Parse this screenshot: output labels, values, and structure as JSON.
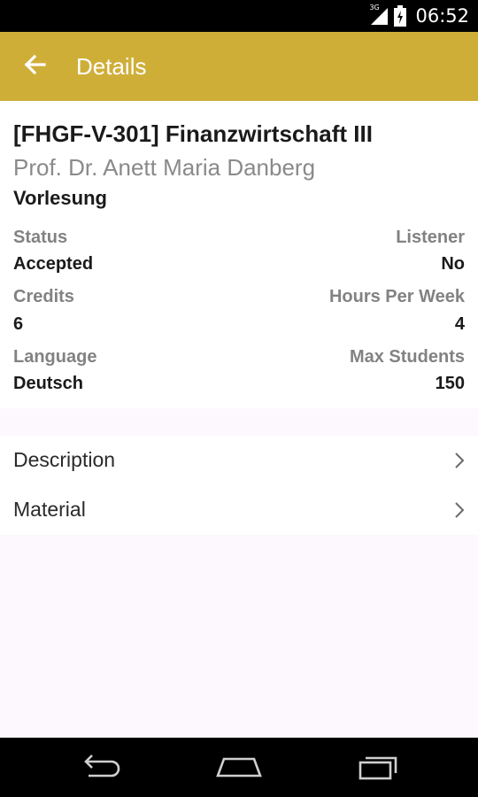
{
  "status_bar": {
    "network_type": "3G",
    "time": "06:52",
    "icons": [
      "signal-icon",
      "battery-icon"
    ]
  },
  "app_bar": {
    "title": "Details",
    "back_icon": "arrow-left-icon",
    "color": "#cfae38"
  },
  "course": {
    "title": "[FHGF-V-301] Finanzwirtschaft III",
    "professor": "Prof. Dr. Anett Maria Danberg",
    "type": "Vorlesung"
  },
  "info": {
    "status_label": "Status",
    "status_value": "Accepted",
    "listener_label": "Listener",
    "listener_value": "No",
    "credits_label": "Credits",
    "credits_value": "6",
    "hours_label": "Hours Per Week",
    "hours_value": "4",
    "language_label": "Language",
    "language_value": "Deutsch",
    "max_students_label": "Max Students",
    "max_students_value": "150"
  },
  "links": {
    "items": [
      {
        "label": "Description",
        "icon": "chevron-right-icon"
      },
      {
        "label": "Material",
        "icon": "chevron-right-icon"
      }
    ]
  },
  "system_nav": {
    "icons": [
      "back-icon",
      "home-icon",
      "recent-apps-icon"
    ]
  }
}
